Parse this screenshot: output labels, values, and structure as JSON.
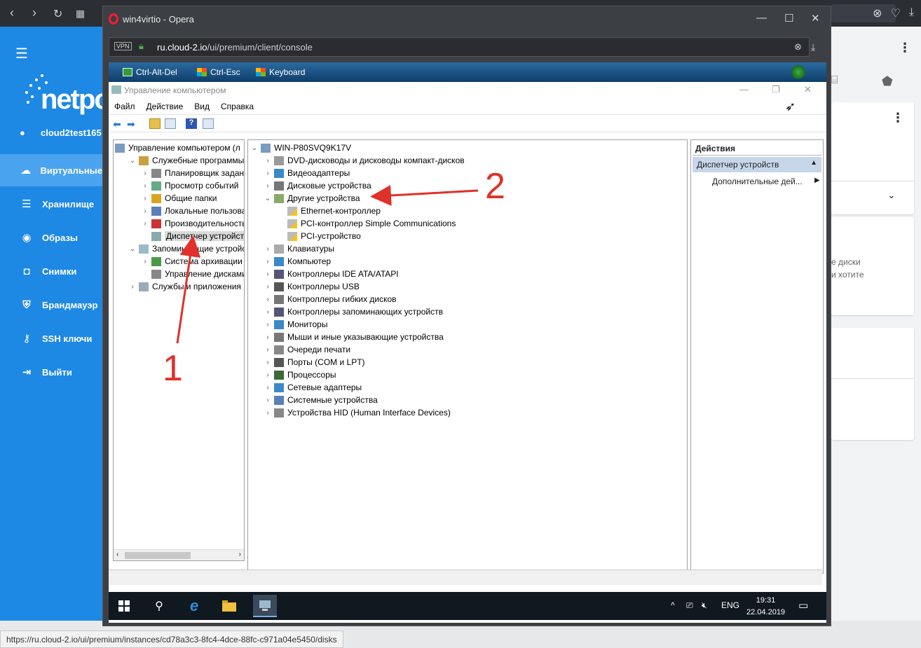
{
  "outer_browser": {
    "status_url": "https://ru.cloud-2.io/ui/premium/instances/cd78a3c3-8fc4-4dce-88fc-c971a04e5450/disks"
  },
  "sidebar": {
    "brand": "netpo",
    "user": "cloud2test165",
    "items": [
      {
        "label": "Виртуальные",
        "icon": "cloud-icon",
        "active": true
      },
      {
        "label": "Хранилище",
        "icon": "storage-icon",
        "active": false
      },
      {
        "label": "Образы",
        "icon": "disc-icon",
        "active": false
      },
      {
        "label": "Снимки",
        "icon": "camera-icon",
        "active": false
      },
      {
        "label": "Брандмауэр",
        "icon": "shield-icon",
        "active": false
      },
      {
        "label": "SSH ключи",
        "icon": "key-icon",
        "active": false
      },
      {
        "label": "Выйти",
        "icon": "logout-icon",
        "active": false
      }
    ]
  },
  "right_panel": {
    "hint_line1": "е диски",
    "hint_line2": "и хотите"
  },
  "opera": {
    "title": "win4virtio - Opera",
    "vpn": "VPN",
    "url_domain": "ru.cloud-2.io",
    "url_path": "/ui/premium/client/console"
  },
  "novnc": {
    "buttons": [
      "Ctrl-Alt-Del",
      "Ctrl-Esc",
      "Keyboard"
    ]
  },
  "mmc": {
    "title": "Управление компьютером",
    "menu": [
      "Файл",
      "Действие",
      "Вид",
      "Справка"
    ],
    "left_tree": [
      {
        "label": "Управление компьютером (л",
        "level": 0,
        "chev": ""
      },
      {
        "label": "Служебные программы",
        "level": 1,
        "chev": "v"
      },
      {
        "label": "Планировщик заданий",
        "level": 2,
        "chev": ">"
      },
      {
        "label": "Просмотр событий",
        "level": 2,
        "chev": ">"
      },
      {
        "label": "Общие папки",
        "level": 2,
        "chev": ">"
      },
      {
        "label": "Локальные пользовате",
        "level": 2,
        "chev": ">"
      },
      {
        "label": "Производительность",
        "level": 2,
        "chev": ">"
      },
      {
        "label": "Диспетчер устройств",
        "level": 2,
        "chev": "",
        "selected": true
      },
      {
        "label": "Запоминающие устройст",
        "level": 1,
        "chev": "v"
      },
      {
        "label": "Система архивации да",
        "level": 2,
        "chev": ">"
      },
      {
        "label": "Управление дисками",
        "level": 2,
        "chev": ""
      },
      {
        "label": "Службы и приложения",
        "level": 1,
        "chev": ">"
      }
    ],
    "device_root": "WIN-P80SVQ9K17V",
    "devices": [
      {
        "label": "DVD-дисководы и дисководы компакт-дисков",
        "level": 1,
        "chev": ">"
      },
      {
        "label": "Видеоадаптеры",
        "level": 1,
        "chev": ">"
      },
      {
        "label": "Дисковые устройства",
        "level": 1,
        "chev": ">"
      },
      {
        "label": "Другие устройства",
        "level": 1,
        "chev": "v"
      },
      {
        "label": "Ethernet-контроллер",
        "level": 2,
        "chev": "",
        "warn": true
      },
      {
        "label": "PCI-контроллер Simple Communications",
        "level": 2,
        "chev": "",
        "warn": true
      },
      {
        "label": "PCI-устройство",
        "level": 2,
        "chev": "",
        "warn": true
      },
      {
        "label": "Клавиатуры",
        "level": 1,
        "chev": ">"
      },
      {
        "label": "Компьютер",
        "level": 1,
        "chev": ">"
      },
      {
        "label": "Контроллеры IDE ATA/ATAPI",
        "level": 1,
        "chev": ">"
      },
      {
        "label": "Контроллеры USB",
        "level": 1,
        "chev": ">"
      },
      {
        "label": "Контроллеры гибких дисков",
        "level": 1,
        "chev": ">"
      },
      {
        "label": "Контроллеры запоминающих устройств",
        "level": 1,
        "chev": ">"
      },
      {
        "label": "Мониторы",
        "level": 1,
        "chev": ">"
      },
      {
        "label": "Мыши и иные указывающие устройства",
        "level": 1,
        "chev": ">"
      },
      {
        "label": "Очереди печати",
        "level": 1,
        "chev": ">"
      },
      {
        "label": "Порты (COM и LPT)",
        "level": 1,
        "chev": ">"
      },
      {
        "label": "Процессоры",
        "level": 1,
        "chev": ">"
      },
      {
        "label": "Сетевые адаптеры",
        "level": 1,
        "chev": ">"
      },
      {
        "label": "Системные устройства",
        "level": 1,
        "chev": ">"
      },
      {
        "label": "Устройства HID (Human Interface Devices)",
        "level": 1,
        "chev": ">"
      }
    ],
    "actions": {
      "header": "Действия",
      "section": "Диспетчер устройств",
      "more": "Дополнительные дей..."
    }
  },
  "taskbar": {
    "lang": "ENG",
    "time": "19:31",
    "date": "22.04.2019"
  },
  "annotations": {
    "one": "1",
    "two": "2"
  },
  "colors": {
    "sidebar_blue": "#1e88e5",
    "sidebar_active": "#4aa3ee",
    "annotation_red": "#e0312a"
  }
}
